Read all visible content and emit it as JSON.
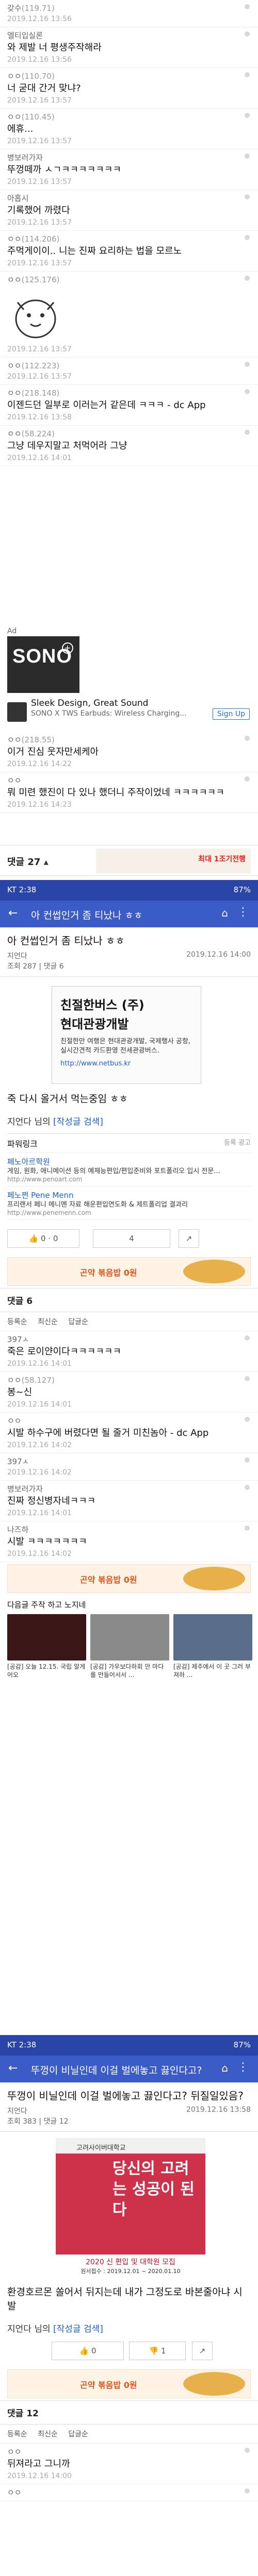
{
  "comments_top": [
    {
      "nick": "갖수",
      "ip": "(119.71)",
      "text": "",
      "time": "2019.12.16 13:56",
      "sticker": false
    },
    {
      "nick": "엘티입실론",
      "ip": "",
      "text": "와 제발 너 평생주작해라",
      "time": "2019.12.16 13:56",
      "sticker": false
    },
    {
      "nick": "ㅇㅇ",
      "ip": "(110.70)",
      "text": "너 굳대 간거 맞냐?",
      "time": "2019.12.16 13:57",
      "sticker": false
    },
    {
      "nick": "ㅇㅇ",
      "ip": "(110.45)",
      "text": "에휴...",
      "time": "2019.12.16 13:57",
      "sticker": false
    },
    {
      "nick": "병보러가자",
      "ip": "",
      "text": "뚜껑떼까 ㅅㄱㅋㅋㅋㅋㅋㅋㅋ",
      "time": "2019.12.16 13:57",
      "sticker": false
    },
    {
      "nick": "아홉시",
      "ip": "",
      "text": "기록했어 까렸다",
      "time": "2019.12.16 13:57",
      "sticker": false
    },
    {
      "nick": "ㅇㅇ",
      "ip": "(114.206)",
      "text": "주먹게이이.. 니는 진짜 요리하는 법을 모르노",
      "time": "2019.12.16 13:57",
      "sticker": false
    },
    {
      "nick": "ㅇㅇ",
      "ip": "(125.176)",
      "text": "",
      "time": "2019.12.16 13:57",
      "sticker": true
    },
    {
      "nick": "ㅇㅇ",
      "ip": "(112.223)",
      "text": "",
      "time": "2019.12.16 13:57",
      "sticker": false
    },
    {
      "nick": "ㅇㅇ",
      "ip": "(218.148)",
      "text": "이젠드던 일부로 이러는거 같은데 ㅋㅋㅋ - dc App",
      "time": "2019.12.16 13:58",
      "sticker": false
    },
    {
      "nick": "ㅇㅇ",
      "ip": "(58.224)",
      "text": "그냥 데우지말고 처먹어라 그냥",
      "time": "2019.12.16 14:01",
      "sticker": false
    }
  ],
  "ad": {
    "label": "Ad",
    "logo": "SONO",
    "title": "Sleek Design, Great Sound",
    "subtitle": "SONO X TWS Earbuds: Wireless Charging...",
    "button": "Sign Up"
  },
  "comments_mid": [
    {
      "nick": "ㅇㅇ",
      "ip": "(218.55)",
      "text": "이거 진심 웃자만세케아",
      "time": "2019.12.16 14:22"
    },
    {
      "nick": "ㅇㅇ",
      "ip": "",
      "text": "뭐 미련 했진이 다 있나 했더니 주작이었네 ㅋㅋㅋㅋㅋㅋ",
      "time": "2019.12.16 14:23"
    }
  ],
  "footer1": {
    "label": "댓글 27",
    "banner": "최대 1조기전행"
  },
  "phone1": {
    "status_time": "KT 2:38",
    "status_right": "87%",
    "nav_title": "아 컨썹인거 좀 티났나 ㅎㅎ",
    "post_title": "아 컨썹인거 좀 티났나 ㅎㅎ",
    "author": "지언다",
    "date": "2019.12.16 14:00",
    "meta": "조회 287 | 댓글 6",
    "ad_t1": "친절한버스 (주)",
    "ad_t2": "현대관광개발",
    "ad_p": "친절한만 여행은 현대관광개발, 국제행사 공항, 실시간견적 카드환영 전세관광버스.",
    "ad_link": "http://www.netbus.kr",
    "body": "죽 다시 올거서 먹는중임 ㅎㅎ",
    "user_btn": "지언다 님의",
    "user_btn_k": "[작성글 검색]",
    "powerlink": "파워링크",
    "powerlink_ad": "등록 광고",
    "pl": [
      {
        "name": "페노아르학원",
        "desc": "게임, 원화, 애니메이션 등의 예체능편입/편입준비와 포트폴리오 입시 전문...",
        "url": "http://www.penoart.com"
      },
      {
        "name": "페노쩐 Pene Menn",
        "desc": "프리랜서 페니 메니멘 자료 해운편입연도화 & 제트폴리업 결과리",
        "url": "http://www.penemenn.com"
      }
    ],
    "vote_up": "0",
    "vote_down": "0",
    "vote_share": "4",
    "banner": "곤약 볶음밥 0원",
    "count": "댓글 6",
    "sort": [
      "등록순",
      "최신순",
      "답글순"
    ]
  },
  "comments_phone1": [
    {
      "nick": "397ㅅ",
      "ip": "",
      "text": "죽은 로이얀이다ㅋㅋㅋㅋㅋㅋ",
      "time": "2019.12.16 14:01"
    },
    {
      "nick": "ㅇㅇ",
      "ip": "(58.127)",
      "text": "봉~신",
      "time": "2019.12.16 14:01"
    },
    {
      "nick": "ㅇㅇ",
      "ip": "",
      "text": "시발 하수구에 버렸다면 될 줄거 미친놈아 - dc App",
      "time": "2019.12.16 14:02"
    },
    {
      "nick": "397ㅅ",
      "ip": "",
      "text": "",
      "time": "2019.12.16 14:02"
    },
    {
      "nick": "병보러가자",
      "ip": "",
      "text": "진짜 정신병자네ㅋㅋㅋ",
      "time": "2019.12.16 14:01"
    },
    {
      "nick": "나즈하",
      "ip": "",
      "text": "시발 ㅋㅋㅋㅋㅋㅋㅋ",
      "time": "2019.12.16 14:02"
    }
  ],
  "footer2": {
    "count": "댓글 6",
    "sort": "등록순 · 최신순 · 답글순",
    "banner": "곤약 볶음밥 0원"
  },
  "related": {
    "head": "다음글  주작 하고 노지네",
    "items": [
      "[공감] 오늘 12.15. 국립 알게어오",
      "[공감] 가우보다하회 안 마다를 만들어서서 ...",
      "[공감] 제주에서 이 곳 그러 부져하 ..."
    ]
  },
  "phone2": {
    "status_time": "KT 2:38",
    "status_right": "87%",
    "nav_title": "뚜껑이 비닐인데 이걸 벌에놓고 끓인다고?",
    "post_title": "뚜껑이 비닐인데 이걸 벌에놓고 끓인다고? 뒤질일있음?",
    "author": "지언다",
    "date": "2019.12.16 13:58",
    "meta": "조회 383 | 댓글 12",
    "uni": "고려사이버대학교",
    "uni_big": "당신의 고려는 성공이 된다",
    "uni_bottom": "2020 신 편입 및 대학원 모집",
    "uni_small": "원서접수 : 2019.12.01 ~ 2020.01.10",
    "body": "환경호르몬 쏠어서 뒤지는데 내가 그정도로 바본줄아냐 시발",
    "user_btn": "지언다 님의",
    "user_btn_k": "[작성글 검색]",
    "vote_up": "0",
    "vote_down": "1",
    "banner": "곤약 볶음밥 0원",
    "count": "댓글 12",
    "sort": [
      "등록순",
      "최신순",
      "답글순"
    ]
  },
  "comments_bottom": [
    {
      "nick": "ㅇㅇ",
      "ip": "",
      "text": "뒤져라고 그니까",
      "time": "2019.12.16 14:00"
    },
    {
      "nick": "ㅇㅇ",
      "ip": "",
      "text": "",
      "time": ""
    }
  ],
  "colors": {
    "blue_nav": "#3b5bc7",
    "blue_status": "#2945a8",
    "link": "#1a5fcc",
    "banner_text": "#e2551b"
  }
}
